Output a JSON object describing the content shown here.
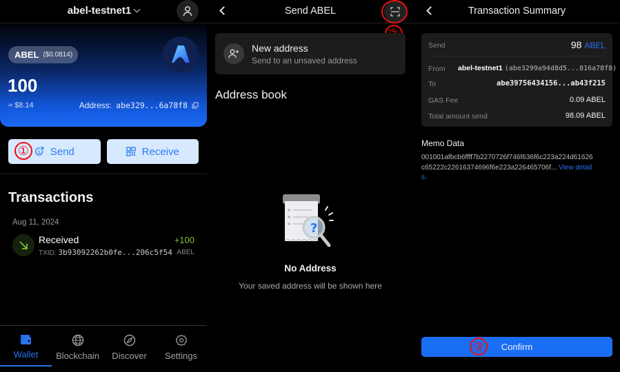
{
  "wallet_screen": {
    "network": "abel-testnet1",
    "token_symbol": "ABEL",
    "token_price": "($0.0814)",
    "balance": "100",
    "fiat_value": "≈ $8.14",
    "address_label": "Address:",
    "address_value": "abe329...6a78f8",
    "send_label": "Send",
    "receive_label": "Receive",
    "transactions_title": "Transactions",
    "transactions": [
      {
        "date": "Aug 11, 2024",
        "type": "Received",
        "txid_label": "TXID:",
        "txid": "3b93092262b0fe...206c5f54",
        "amount": "+100",
        "unit": "ABEL"
      }
    ],
    "nav": [
      {
        "label": "Wallet",
        "icon": "wallet-icon",
        "active": true
      },
      {
        "label": "Blockchain",
        "icon": "globe-icon",
        "active": false
      },
      {
        "label": "Discover",
        "icon": "compass-icon",
        "active": false
      },
      {
        "label": "Settings",
        "icon": "gear-icon",
        "active": false
      }
    ]
  },
  "send_screen": {
    "title": "Send ABEL",
    "new_address_title": "New address",
    "new_address_subtitle": "Send to an unsaved address",
    "address_book_title": "Address book",
    "empty_title": "No Address",
    "empty_subtitle": "Your saved address will be shown here"
  },
  "summary_screen": {
    "title": "Transaction Summary",
    "send_label": "Send",
    "send_amount": "98",
    "send_unit": "ABEL",
    "from_label": "From",
    "from_name": "abel-testnet1",
    "from_address": "(abe3299a94d8d5...816a78f8)",
    "to_label": "To",
    "to_address": "abe39756434156...ab43f215",
    "gas_label": "GAS Fee",
    "gas_value": "0.09 ABEL",
    "total_label": "Total amount send",
    "total_value": "98.09 ABEL",
    "memo_title": "Memo Data",
    "memo_value": "001001afbcb6ffff7b2270726f746f636f6c223a224d61626c65222c22616374696f6e223a226465706f...",
    "memo_link": "View details.",
    "confirm_label": "Confirm"
  },
  "annotations": {
    "step1": "①",
    "step2": "②",
    "step3": "③",
    "color": "#e11111"
  }
}
